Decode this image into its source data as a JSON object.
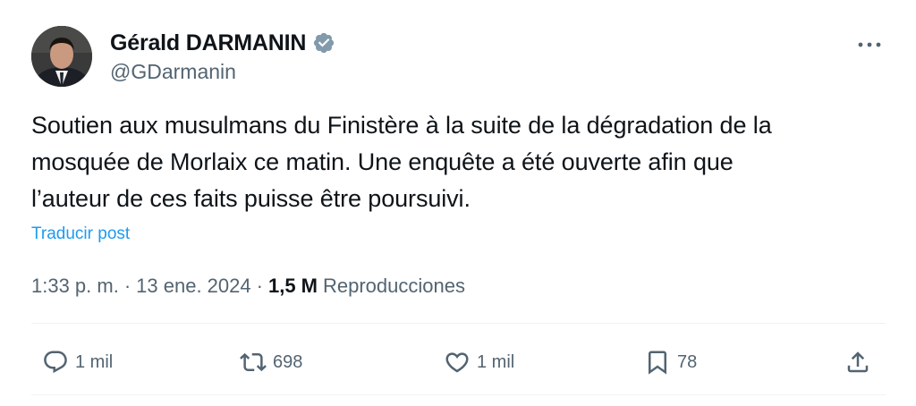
{
  "author": {
    "display_name": "Gérald DARMANIN",
    "handle": "@GDarmanin",
    "avatar_icon": "profile-photo",
    "verified_icon": "verified-badge-icon",
    "verified_color": "#829aab"
  },
  "tweet": {
    "lines": [
      "Soutien aux musulmans du Finistère à la suite de la dégradation de la",
      "mosquée de Morlaix ce matin. Une enquête a été ouverte afin que",
      "l’auteur de ces faits puisse être poursuivi."
    ],
    "translate_label": "Traducir post"
  },
  "meta": {
    "time": "1:33 p. m.",
    "separator": "·",
    "date": "13 ene. 2024",
    "views_count": "1,5 M",
    "views_label": "Reproducciones"
  },
  "actions": {
    "reply": {
      "icon": "reply-icon",
      "count": "1 mil"
    },
    "retweet": {
      "icon": "retweet-icon",
      "count": "698"
    },
    "like": {
      "icon": "heart-icon",
      "count": "1 mil"
    },
    "bookmark": {
      "icon": "bookmark-icon",
      "count": "78"
    },
    "share": {
      "icon": "share-icon"
    }
  },
  "colors": {
    "text_primary": "#0f1419",
    "text_secondary": "#536471",
    "link": "#1d9bf0",
    "divider": "#eff3f4"
  }
}
